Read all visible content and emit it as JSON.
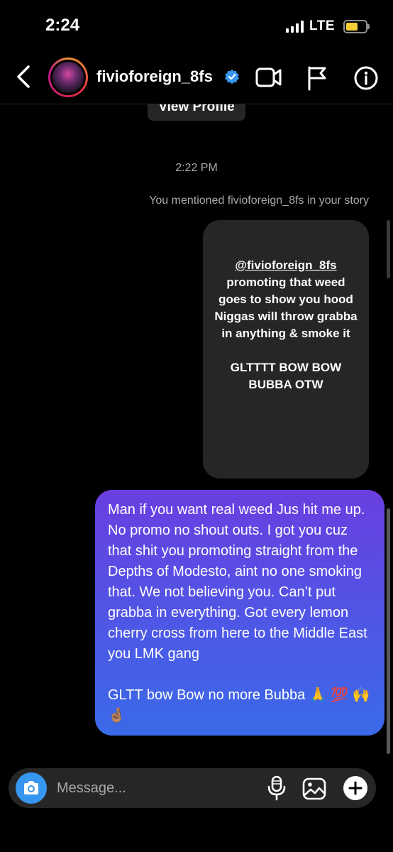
{
  "status_bar": {
    "time": "2:24",
    "network": "LTE"
  },
  "header": {
    "username": "fivioforeign_8fs"
  },
  "view_profile_label": "View Profile",
  "timestamp": "2:22 PM",
  "mention_note": "You mentioned fivioforeign_8fs in your story",
  "story": {
    "handle": "@fivioforeign_8fs",
    "body": "promoting that  weed goes to show you hood Niggas will throw grabba in anything & smoke it",
    "tail": "GLTTTT BOW BOW BUBBA OTW"
  },
  "message": {
    "paragraph1": "Man if you want real weed Jus hit me up. No promo no shout outs. I got you cuz that shit you promoting straight from the Depths of Modesto, aint no one smoking that. We not believing you. Can’t put grabba in everything. Got every lemon cherry cross from here to the Middle East you LMK gang",
    "paragraph2": "GLTT bow Bow no more Bubba 🙏 💯 🙌 🤞🏽"
  },
  "composer": {
    "placeholder": "Message..."
  },
  "colors": {
    "background": "#000000",
    "bubble_gradient_top": "#6a3ee0",
    "bubble_gradient_bottom": "#3a6ae8",
    "story_card": "#262626",
    "camera_button": "#3797f0",
    "verified_badge": "#3797f0"
  },
  "icons": [
    "back-chevron-icon",
    "verified-badge-icon",
    "video-call-icon",
    "flag-icon",
    "info-icon",
    "camera-icon",
    "microphone-icon",
    "gallery-icon",
    "plus-icon",
    "signal-icon",
    "battery-icon"
  ]
}
